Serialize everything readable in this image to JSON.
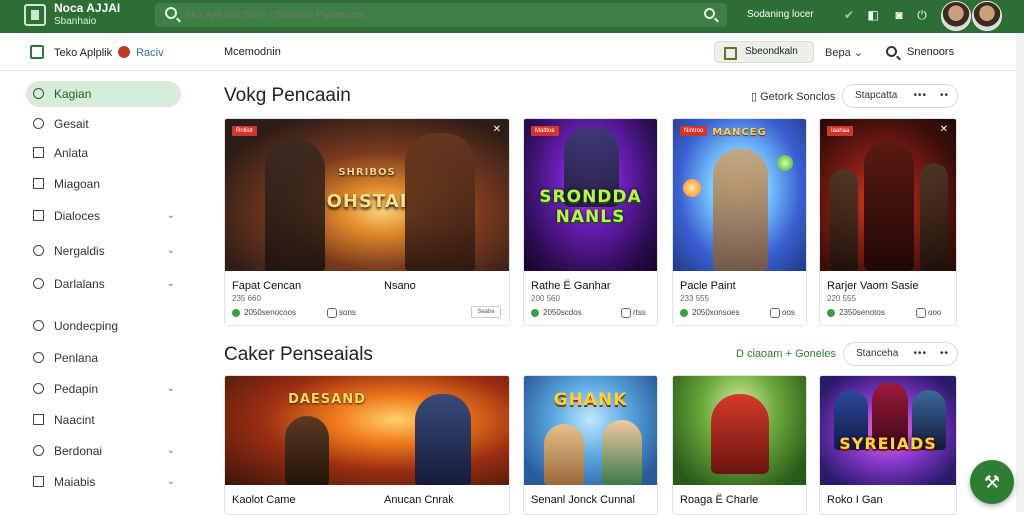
{
  "topbar": {
    "app_name": "Noca AJJAI",
    "app_sub": "Sbanhaio",
    "search_placeholder": "Sko Apit Gilr Stein · Sbmbinc Palsencme",
    "link": "Sodaning locer"
  },
  "subbar": {
    "title": "Teko Aplplik",
    "version": "Raciv",
    "nav": "Mcemodnin",
    "button": "Sbeondkaln",
    "dropdown": "Bepa",
    "right": "Snenoors"
  },
  "sidebar": {
    "items": [
      {
        "label": "Kagian"
      },
      {
        "label": "Gesait"
      },
      {
        "label": "Anlata"
      },
      {
        "label": "Miagoan"
      },
      {
        "label": "Dialoces"
      },
      {
        "label": "Nergaldis"
      },
      {
        "label": "Darlalans"
      },
      {
        "label": "Uondecping"
      },
      {
        "label": "Penlana"
      },
      {
        "label": "Pedapin"
      },
      {
        "label": "Naacint"
      },
      {
        "label": "Berdonai"
      },
      {
        "label": "Maiabis"
      }
    ]
  },
  "section1": {
    "title": "Vokg Pencaain",
    "link": "Getork Sonclos",
    "button": "Stapcatta",
    "cards": [
      {
        "badge": "Rnlliot",
        "art": "OHSTAI",
        "art_top": "SHRIBOS",
        "title": "Fapat Cencan",
        "title2": "Nsano",
        "meta1": "235 660",
        "meta2": "2050senocoos",
        "meta3": "sons",
        "pill": "Seabe"
      },
      {
        "badge": "Malttoe",
        "art": "SRONDDA NANLS",
        "title": "Rathe Ë Ganhar",
        "meta1": "200 560",
        "meta2": "2050scdos",
        "meta3": "rtss"
      },
      {
        "badge": "Nintroo",
        "art": "MANCEG",
        "title": "Pacle Paint",
        "meta1": "233 555",
        "meta2": "2050xonsoes",
        "meta3": "oos"
      },
      {
        "badge": "Iaahaa",
        "art": "",
        "title": "Rarjer Vaom Sasie",
        "meta1": "220 555",
        "meta2": "2350senotos",
        "meta3": "ooo"
      }
    ]
  },
  "section2": {
    "title": "Caker Penseaials",
    "link": "D ciaoam + Goneles",
    "button": "Stanceha",
    "cards": [
      {
        "art": "DAESAND",
        "title": "Kaolot Came",
        "title2": "Anucan Cnrak"
      },
      {
        "art": "GHANK",
        "title": "Senanl Jonck Cunnal"
      },
      {
        "art": "",
        "title": "Roaga Ë Charle"
      },
      {
        "art": "SYREIADS",
        "title": "Roko I Gan"
      }
    ]
  },
  "colors": {
    "topbar": "#2c6e34",
    "accent": "#2e7d32",
    "active_nav": "#d7ecd8",
    "badge": "#d3342b"
  }
}
